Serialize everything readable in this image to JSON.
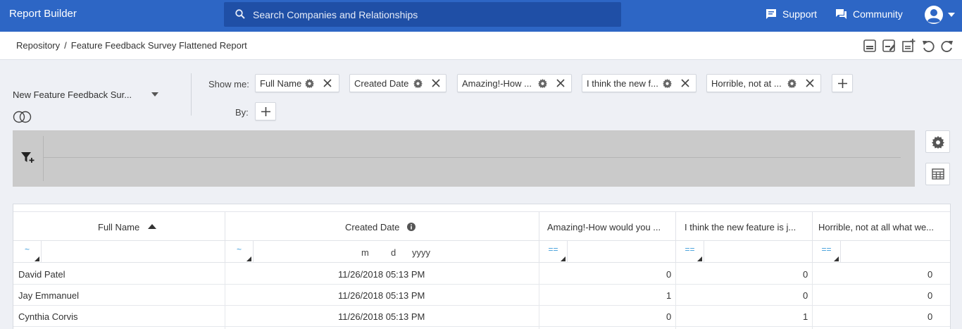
{
  "header": {
    "app_title": "Report Builder",
    "search_placeholder": "Search Companies and Relationships",
    "support_label": "Support",
    "community_label": "Community"
  },
  "breadcrumb": {
    "root": "Repository",
    "separator": "/",
    "current": "Feature Feedback Survey Flattened Report"
  },
  "toolbar": {
    "icons": [
      "save-icon",
      "save-as-icon",
      "add-report-icon",
      "undo-icon",
      "refresh-icon"
    ]
  },
  "config": {
    "source_object": "New Feature Feedback Sur...",
    "show_me_label": "Show me:",
    "by_label": "By:",
    "fields": [
      {
        "label": "Full Name"
      },
      {
        "label": "Created Date"
      },
      {
        "label": "Amazing!-How ..."
      },
      {
        "label": "I think the new f..."
      },
      {
        "label": "Horrible, not at ..."
      }
    ]
  },
  "grid": {
    "columns": [
      {
        "label": "Full Name",
        "filter_op": "~"
      },
      {
        "label": "Created Date",
        "filter_op": "~",
        "date_placeholder": {
          "m": "m",
          "d": "d",
          "y": "yyyy"
        }
      },
      {
        "label": "Amazing!-How would you ...",
        "filter_op": "=="
      },
      {
        "label": "I think the new feature is j...",
        "filter_op": "=="
      },
      {
        "label": "Horrible, not at all what we...",
        "filter_op": "=="
      }
    ],
    "rows": [
      {
        "full_name": "David Patel",
        "created": "11/26/2018 05:13 PM",
        "amazing": "0",
        "think": "0",
        "horrible": "0"
      },
      {
        "full_name": "Jay Emmanuel",
        "created": "11/26/2018 05:13 PM",
        "amazing": "1",
        "think": "0",
        "horrible": "0"
      },
      {
        "full_name": "Cynthia Corvis",
        "created": "11/26/2018 05:13 PM",
        "amazing": "0",
        "think": "1",
        "horrible": "0"
      }
    ]
  },
  "colors": {
    "brand_blue": "#2d66c5",
    "search_blue": "#1f4fa6",
    "filter_op_blue": "#3a9ad9"
  }
}
